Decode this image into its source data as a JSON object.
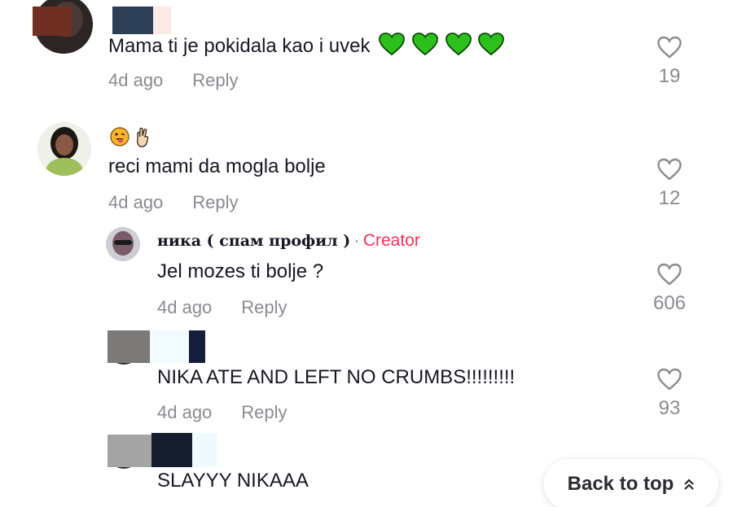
{
  "comments": [
    {
      "text": "Mama ti je pokidala kao i uvek",
      "emoji": [
        "green-heart",
        "green-heart",
        "green-heart",
        "green-heart"
      ],
      "time": "4d ago",
      "reply_label": "Reply",
      "likes": "19"
    },
    {
      "emoji_line": [
        "tongue-wink-emoji",
        "crossed-fingers-emoji"
      ],
      "text": "reci mami da mogla bolje",
      "time": "4d ago",
      "reply_label": "Reply",
      "likes": "12"
    },
    {
      "username": "ника ( спам профил )",
      "separator": "·",
      "badge": "Creator",
      "text": "Jel mozes ti bolje ?",
      "time": "4d ago",
      "reply_label": "Reply",
      "likes": "606"
    },
    {
      "text": "NIKA ATE AND LEFT NO CRUMBS!!!!!!!!!",
      "time": "4d ago",
      "reply_label": "Reply",
      "likes": "93"
    },
    {
      "text": "SLAYYY NIKAAA"
    }
  ],
  "back_to_top": {
    "label": "Back to top",
    "icon": "double-chevron-up-icon"
  },
  "colors": {
    "creator_badge": "#fe2c55",
    "meta_text": "#8a8b91",
    "heart_emoji": "#2dbf1c"
  }
}
